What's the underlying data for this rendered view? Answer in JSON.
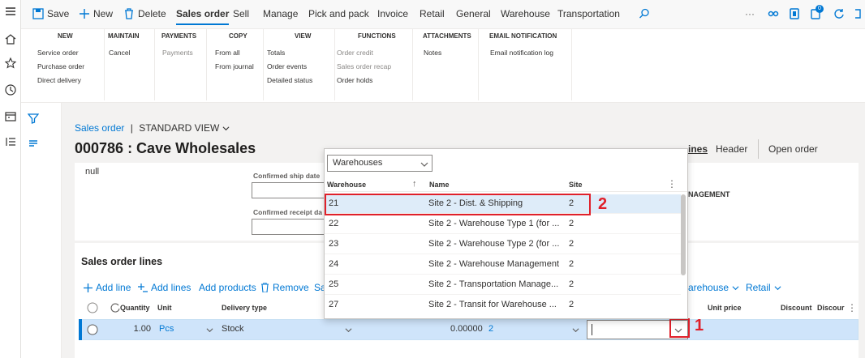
{
  "actionbar": {
    "save": "Save",
    "new": "New",
    "delete": "Delete",
    "tabs": [
      "Sales order",
      "Sell",
      "Manage",
      "Pick and pack",
      "Invoice",
      "Retail",
      "General",
      "Warehouse",
      "Transportation"
    ],
    "more": "···",
    "badge_count": "0"
  },
  "ribbon": {
    "groups": [
      {
        "title": "NEW",
        "items": [
          "Service order",
          "Purchase order",
          "Direct delivery"
        ]
      },
      {
        "title": "MAINTAIN",
        "items": [
          "Cancel"
        ]
      },
      {
        "title": "PAYMENTS",
        "items": [
          "Payments"
        ]
      },
      {
        "title": "COPY",
        "items": [
          "From all",
          "From journal"
        ]
      },
      {
        "title": "VIEW",
        "items": [
          "Totals",
          "Order events",
          "Detailed status"
        ]
      },
      {
        "title": "FUNCTIONS",
        "items": [
          "Order credit",
          "Sales order recap",
          "Order holds"
        ]
      },
      {
        "title": "ATTACHMENTS",
        "items": [
          "Notes"
        ]
      },
      {
        "title": "EMAIL NOTIFICATION",
        "items": [
          "Email notification log"
        ]
      }
    ]
  },
  "breadcrumb": {
    "page": "Sales order",
    "separator": "|",
    "view": "STANDARD VIEW"
  },
  "record_title": "000786 : Cave Wholesales",
  "header_card": {
    "null_text": "null",
    "confirmed_ship_label": "Confirmed ship date",
    "confirmed_receipt_label": "Confirmed receipt da",
    "management_label": "NAGEMENT"
  },
  "tabs": {
    "lines": "ines",
    "header": "Header",
    "open_order": "Open order"
  },
  "lines": {
    "title": "Sales order lines",
    "toolbar": {
      "add_line": "Add line",
      "add_lines": "Add lines",
      "add_products": "Add products",
      "remove": "Remove",
      "sa": "Sa",
      "warehouse": "arehouse",
      "retail": "Retail"
    },
    "columns": {
      "quantity": "Quantity",
      "unit": "Unit",
      "delivery_type": "Delivery type",
      "unit_price": "Unit price",
      "discount": "Discount",
      "discount2": "Discour"
    },
    "row": {
      "quantity": "1.00",
      "unit": "Pcs",
      "delivery_type": "Stock",
      "amount": "0.00000",
      "site": "2"
    }
  },
  "lookup": {
    "selector": "Warehouses",
    "columns": {
      "warehouse": "Warehouse",
      "name": "Name",
      "site": "Site"
    },
    "rows": [
      {
        "warehouse": "21",
        "name": "Site 2 - Dist. & Shipping",
        "site": "2"
      },
      {
        "warehouse": "22",
        "name": "Site 2 - Warehouse Type 1 (for ...",
        "site": "2"
      },
      {
        "warehouse": "23",
        "name": "Site 2 - Warehouse Type 2 (for ...",
        "site": "2"
      },
      {
        "warehouse": "24",
        "name": "Site 2 - Warehouse Management",
        "site": "2"
      },
      {
        "warehouse": "25",
        "name": "Site 2 - Transportation Manage...",
        "site": "2"
      },
      {
        "warehouse": "27",
        "name": "Site 2 - Transit for Warehouse ...",
        "site": "2"
      }
    ]
  },
  "annotations": {
    "one": "1",
    "two": "2"
  },
  "colors": {
    "accent": "#0078d4",
    "annotation": "#e0202a",
    "selected_row": "#cfe4fa"
  }
}
